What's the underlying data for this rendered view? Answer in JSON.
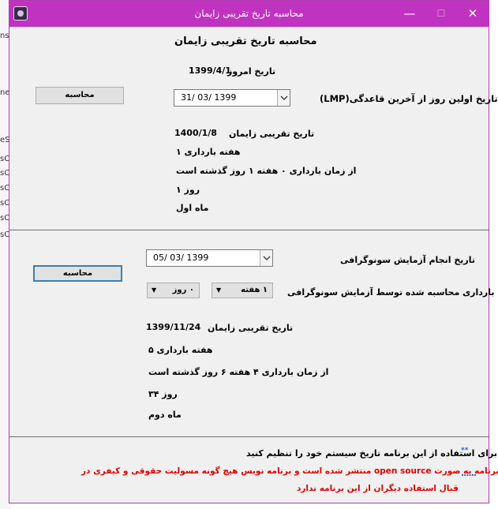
{
  "window": {
    "title": "محاسبه تاریخ تقریبی زایمان",
    "controls": {
      "minimize": "—",
      "maximize": "☐",
      "close": "✕"
    }
  },
  "background_app": {
    "fragments": [
      "ns",
      "ne",
      "eS",
      "sC",
      "sC",
      "sC",
      "sC",
      "sC",
      "sC"
    ]
  },
  "section1": {
    "heading": "محاسبه تاریخ تقریبی زایمان",
    "today_label": "تاریخ امروز",
    "today_value": "1399/4/1",
    "lmp_label": "تاریخ اولین روز از آخرین قاعدگی(LMP)",
    "lmp_date": "31/ 03/ 1399",
    "calc_button": "محاسبه",
    "result": {
      "due_label": "تاریخ تقریبی زایمان",
      "due_value": "1400/1/8",
      "week_line": "هفته بارداری ۱",
      "elapsed_line": "از زمان بارداری ۰ هفته ۱ روز گذشته است",
      "day_line": "روز ۱",
      "month_line": "ماه اول"
    }
  },
  "section2": {
    "sono_date_label": "تاریخ انجام آزمایش سونوگرافی",
    "sono_date": "05/ 03/ 1399",
    "age_label": "سن بارداری محاسبه شده توسط آزمایش سونوگرافی",
    "weeks_select": "۱ هفته",
    "days_select": "۰ روز",
    "calc_button": "محاسبه",
    "result": {
      "due_label": "تاریخ تقریبی زایمان",
      "due_value": "1399/11/24",
      "week_line": "هفته بارداری ۵",
      "elapsed_line": "از زمان بارداری ۴ هفته ۶ روز گذشته است",
      "day_line": "روز ۳۴",
      "month_line": "ماه دوم"
    }
  },
  "footer": {
    "note_marker": "**",
    "note": "برای استفاده از این برنامه تاریخ سیستم خود را تنظیم کنید",
    "dots": "......",
    "disclaimer_line1": "این برنامه به صورت open source منتشر شده است و برنامه نویس هیچ گونه مسولیت حقوقی و کیفری در",
    "disclaimer_line2": "قبال استفاده دیگران از این برنامه ندارد"
  },
  "colors": {
    "titlebar": "#c033c0",
    "disclaimer": "#e00000",
    "dots": "#3355cc",
    "focus_border": "#3c7fb1"
  }
}
